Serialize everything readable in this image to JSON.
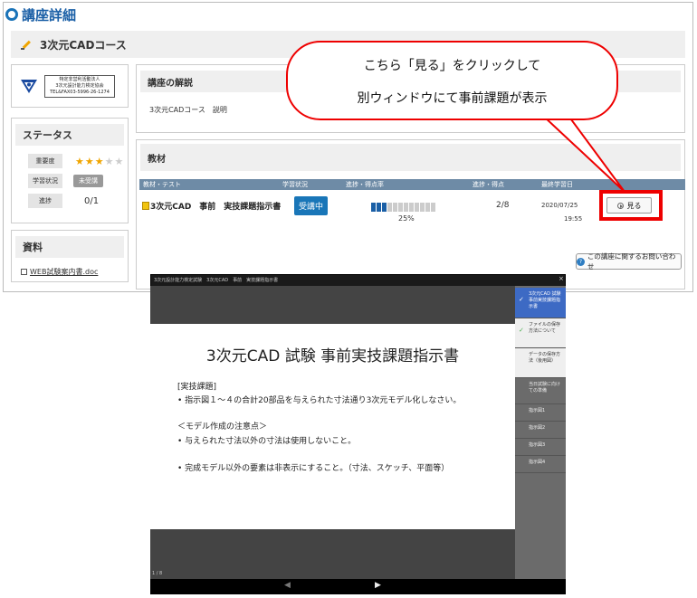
{
  "header": {
    "title": "講座詳細"
  },
  "course": {
    "name": "3次元CADコース"
  },
  "org": {
    "line1": "特定非営利活動法人",
    "line2": "3次元設計能力検定協会",
    "line3": "TEL&FAX03-5996-26-1274"
  },
  "status": {
    "heading": "ステータス",
    "importance_label": "重要度",
    "importance_stars": 3,
    "importance_max": 5,
    "learning_label": "学習状況",
    "learning_badge": "未受講",
    "progress_label": "進捗",
    "progress_value": "0/1"
  },
  "materials": {
    "heading": "資料",
    "link": "WEB試験案内書.doc"
  },
  "explain": {
    "heading": "講座の解説",
    "text": "3次元CADコース　説明"
  },
  "kyozai": {
    "heading": "教材",
    "columns": [
      "教材・テスト",
      "学習状況",
      "進捗・得点率",
      "進捗・得点",
      "最終学習日"
    ],
    "row": {
      "name": "3次元CAD　事前　実技課題指示書",
      "status": "受講中",
      "progress_fraction": 0.25,
      "progress_pct": "25%",
      "steps": "2/8",
      "date": "2020/07/25",
      "time": "19:55",
      "view_label": "見る"
    },
    "inquiry_label": "この講座に関するお問い合わせ"
  },
  "callout": {
    "line1": "こちら「見る」をクリックして",
    "line2": "別ウィンドウにて事前課題が表示"
  },
  "viewer": {
    "title": "3次元設計能力検定試験　3次元CAD　事前　実技課題指示書",
    "close": "×",
    "slide_heading": "3次元CAD 試験 事前実技課題指示書",
    "slide_lines": [
      "[実技課題]",
      "• 指示図１～４の合計20部品を与えられた寸法通り3次元モデル化しなさい。",
      "＜モデル作成の注意点＞",
      "• 与えられた寸法以外の寸法は使用しないこと。",
      "• 完成モデル以外の要素は非表示にすること。（寸法、スケッチ、平面等）"
    ],
    "page_count": "1 / 8",
    "nav_prev": "◀",
    "nav_next": "▶",
    "side_items": [
      "3次元CAD 試験 事前実技課題指示書",
      "ファイルの保存方法について",
      "データの保存方法（後用図）",
      "当日試験に向けての準備",
      "指示図1",
      "指示図2",
      "指示図3",
      "指示図4"
    ]
  }
}
